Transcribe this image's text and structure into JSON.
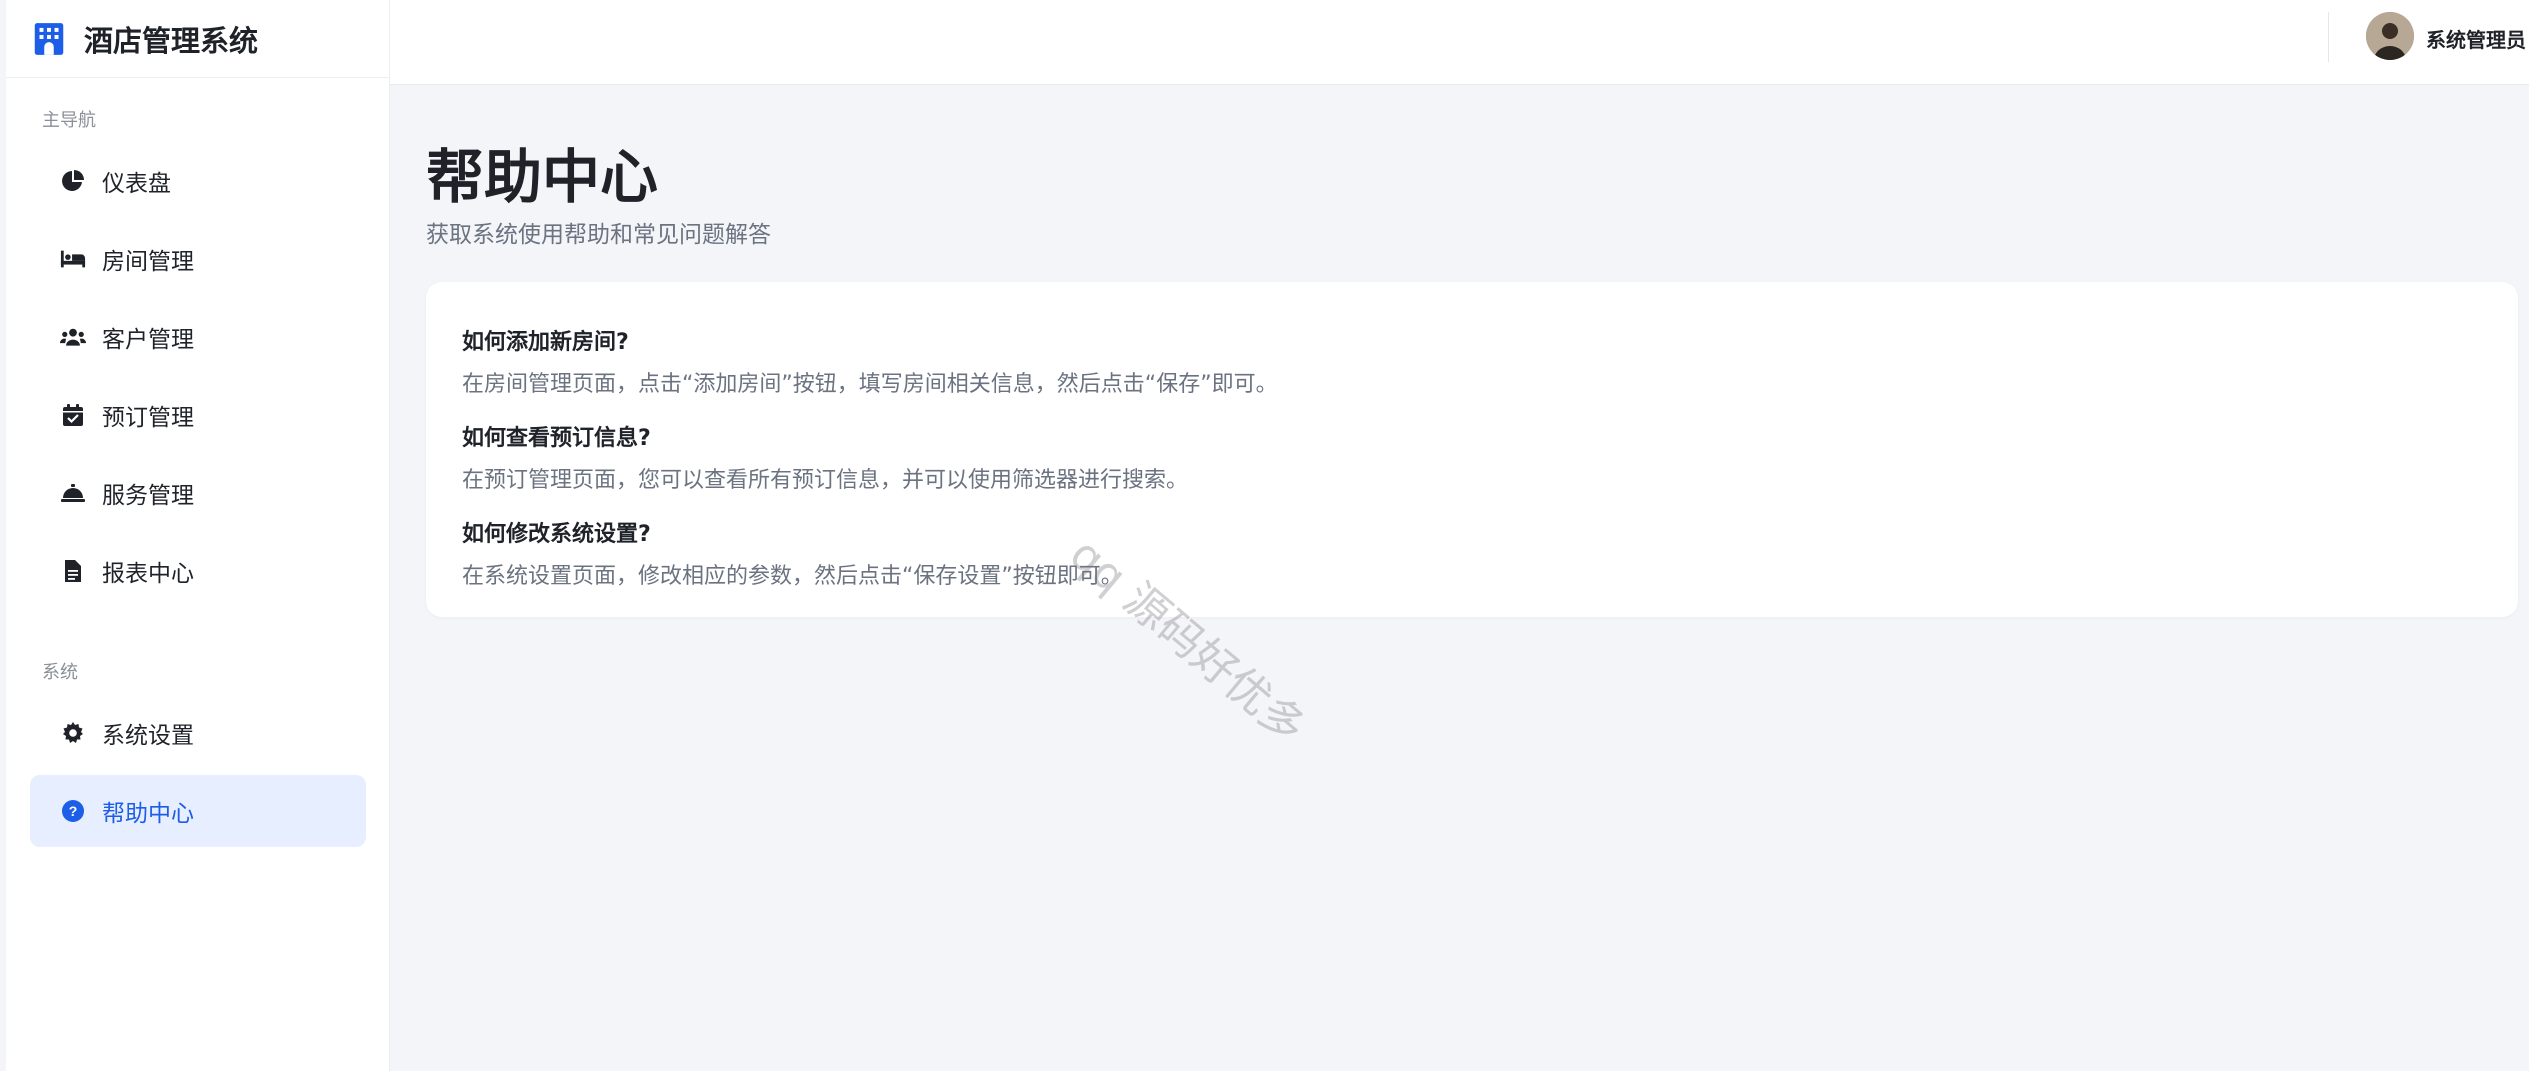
{
  "brand": {
    "title": "酒店管理系统",
    "icon": "hotel-icon"
  },
  "sidebar": {
    "main_label": "主导航",
    "system_label": "系统",
    "main_items": [
      {
        "label": "仪表盘",
        "icon": "pie-chart-icon"
      },
      {
        "label": "房间管理",
        "icon": "bed-icon"
      },
      {
        "label": "客户管理",
        "icon": "users-icon"
      },
      {
        "label": "预订管理",
        "icon": "calendar-check-icon"
      },
      {
        "label": "服务管理",
        "icon": "concierge-bell-icon"
      },
      {
        "label": "报表中心",
        "icon": "file-icon"
      }
    ],
    "system_items": [
      {
        "label": "系统设置",
        "icon": "gear-icon"
      },
      {
        "label": "帮助中心",
        "icon": "question-circle-icon",
        "active": true
      }
    ]
  },
  "header": {
    "username": "系统管理员"
  },
  "page": {
    "title": "帮助中心",
    "subtitle": "获取系统使用帮助和常见问题解答"
  },
  "faq": [
    {
      "q": "如何添加新房间?",
      "a": "在房间管理页面，点击“添加房间”按钮，填写房间相关信息，然后点击“保存”即可。"
    },
    {
      "q": "如何查看预订信息?",
      "a": "在预订管理页面，您可以查看所有预订信息，并可以使用筛选器进行搜索。"
    },
    {
      "q": "如何修改系统设置?",
      "a": "在系统设置页面，修改相应的参数，然后点击“保存设置”按钮即可。"
    }
  ],
  "watermark": "qq 源码好优多",
  "colors": {
    "accent": "#1d5ee8",
    "active_bg": "#e6eeff",
    "background": "#f4f5f9"
  }
}
